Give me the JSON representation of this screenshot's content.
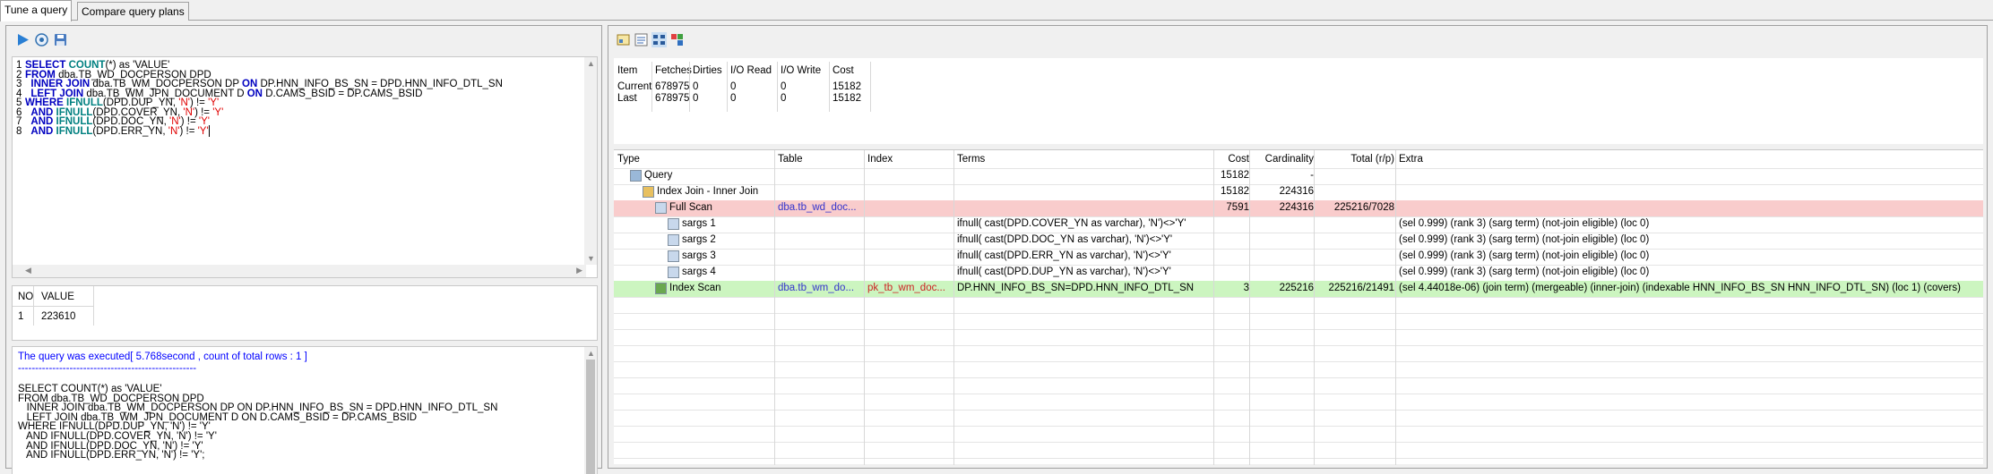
{
  "tabs": [
    {
      "label": "Tune a query",
      "active": true
    },
    {
      "label": "Compare query plans",
      "active": false
    }
  ],
  "toolbar_left": {
    "icons": [
      "run-icon",
      "explain-icon",
      "save-icon"
    ]
  },
  "editor": {
    "lines": [
      {
        "n": "1",
        "parts": [
          [
            "kw",
            "SELECT "
          ],
          [
            "fn",
            "COUNT"
          ],
          [
            "",
            "(*) as 'VALUE'"
          ]
        ]
      },
      {
        "n": "2",
        "parts": [
          [
            "kw",
            "FROM "
          ],
          [
            "",
            "dba.TB_WD_DOCPERSON DPD"
          ]
        ]
      },
      {
        "n": "3",
        "parts": [
          [
            "",
            "  "
          ],
          [
            "kw",
            "INNER JOIN "
          ],
          [
            "",
            "dba.TB_WM_DOCPERSON DP "
          ],
          [
            "kw",
            "ON "
          ],
          [
            "",
            "DP.HNN_INFO_BS_SN = DPD.HNN_INFO_DTL_SN"
          ]
        ]
      },
      {
        "n": "4",
        "parts": [
          [
            "",
            "  "
          ],
          [
            "kw",
            "LEFT JOIN "
          ],
          [
            "",
            "dba.TB_WM_JPN_DOCUMENT D "
          ],
          [
            "kw",
            "ON "
          ],
          [
            "",
            "D.CAMS_BSID = DP.CAMS_BSID"
          ]
        ]
      },
      {
        "n": "5",
        "parts": [
          [
            "kw",
            "WHERE "
          ],
          [
            "fn",
            "IFNULL"
          ],
          [
            "",
            "(DPD.DUP_YN, "
          ],
          [
            "str",
            "'N'"
          ],
          [
            "",
            ") != "
          ],
          [
            "str",
            "'Y'"
          ]
        ]
      },
      {
        "n": "6",
        "parts": [
          [
            "",
            "  "
          ],
          [
            "kw",
            "AND "
          ],
          [
            "fn",
            "IFNULL"
          ],
          [
            "",
            "(DPD.COVER_YN, "
          ],
          [
            "str",
            "'N'"
          ],
          [
            "",
            ") != "
          ],
          [
            "str",
            "'Y'"
          ]
        ]
      },
      {
        "n": "7",
        "parts": [
          [
            "",
            "  "
          ],
          [
            "kw",
            "AND "
          ],
          [
            "fn",
            "IFNULL"
          ],
          [
            "",
            "(DPD.DOC_YN, "
          ],
          [
            "str",
            "'N'"
          ],
          [
            "",
            ") != "
          ],
          [
            "str",
            "'Y'"
          ]
        ]
      },
      {
        "n": "8",
        "parts": [
          [
            "",
            "  "
          ],
          [
            "kw",
            "AND "
          ],
          [
            "fn",
            "IFNULL"
          ],
          [
            "",
            "(DPD.ERR_YN, "
          ],
          [
            "str",
            "'N'"
          ],
          [
            "",
            ") != "
          ],
          [
            "str",
            "'Y'"
          ]
        ]
      }
    ]
  },
  "result_grid": {
    "headers": [
      "NO",
      "VALUE"
    ],
    "rows": [
      [
        "1",
        "223610"
      ]
    ]
  },
  "console": {
    "status": "The query was executed[ 5.768second , count of total rows : 1 ]",
    "separator": "----------------------------------------------------",
    "sql_lines": [
      "SELECT COUNT(*) as 'VALUE'",
      "FROM dba.TB_WD_DOCPERSON DPD",
      "   INNER JOIN dba.TB_WM_DOCPERSON DP ON DP.HNN_INFO_BS_SN = DPD.HNN_INFO_DTL_SN",
      "   LEFT JOIN dba.TB_WM_JPN_DOCUMENT D ON D.CAMS_BSID = DP.CAMS_BSID",
      "WHERE IFNULL(DPD.DUP_YN, 'N') != 'Y'",
      "   AND IFNULL(DPD.COVER_YN, 'N') != 'Y'",
      "   AND IFNULL(DPD.DOC_YN, 'N') != 'Y'",
      "   AND IFNULL(DPD.ERR_YN, 'N') != 'Y';"
    ]
  },
  "toolbar_right": {
    "icons": [
      "plan-graph-icon",
      "plan-text-icon",
      "plan-tree-icon",
      "plan-compare-icon"
    ]
  },
  "stats": {
    "headers": [
      "Item",
      "Fetches",
      "Dirties",
      "I/O Read",
      "I/O Write",
      "Cost"
    ],
    "rows": [
      [
        "Current",
        "678975",
        "0",
        "0",
        "0",
        "15182"
      ],
      [
        "Last",
        "678975",
        "0",
        "0",
        "0",
        "15182"
      ]
    ]
  },
  "plan": {
    "headers": [
      "Type",
      "Table",
      "Index",
      "Terms",
      "Cost",
      "Cardinality",
      "Total (r/p)",
      "Extra"
    ],
    "rows": [
      {
        "type": "Query",
        "icon": "query-icon",
        "indent": 0,
        "table": "",
        "index": "",
        "terms": "",
        "cost": "15182",
        "card": "-",
        "total": "",
        "extra": "",
        "hl": ""
      },
      {
        "type": "Index Join - Inner Join",
        "icon": "folder-icon",
        "indent": 1,
        "table": "",
        "index": "",
        "terms": "",
        "cost": "15182",
        "card": "224316",
        "total": "",
        "extra": "",
        "hl": ""
      },
      {
        "type": "Full Scan",
        "icon": "scan-icon",
        "indent": 2,
        "table": "dba.tb_wd_doc...",
        "index": "",
        "terms": "",
        "cost": "7591",
        "card": "224316",
        "total": "225216/7028",
        "extra": "",
        "hl": "red"
      },
      {
        "type": "sargs 1",
        "icon": "sarg-icon",
        "indent": 3,
        "table": "",
        "index": "",
        "terms": "ifnull( cast(DPD.COVER_YN as varchar), 'N')<>'Y'",
        "cost": "",
        "card": "",
        "total": "",
        "extra": "(sel 0.999) (rank 3) (sarg term) (not-join eligible) (loc 0)",
        "hl": ""
      },
      {
        "type": "sargs 2",
        "icon": "sarg-icon",
        "indent": 3,
        "table": "",
        "index": "",
        "terms": "ifnull( cast(DPD.DOC_YN as varchar), 'N')<>'Y'",
        "cost": "",
        "card": "",
        "total": "",
        "extra": "(sel 0.999) (rank 3) (sarg term) (not-join eligible) (loc 0)",
        "hl": ""
      },
      {
        "type": "sargs 3",
        "icon": "sarg-icon",
        "indent": 3,
        "table": "",
        "index": "",
        "terms": "ifnull( cast(DPD.ERR_YN as varchar), 'N')<>'Y'",
        "cost": "",
        "card": "",
        "total": "",
        "extra": "(sel 0.999) (rank 3) (sarg term) (not-join eligible) (loc 0)",
        "hl": ""
      },
      {
        "type": "sargs 4",
        "icon": "sarg-icon",
        "indent": 3,
        "table": "",
        "index": "",
        "terms": "ifnull( cast(DPD.DUP_YN as varchar), 'N')<>'Y'",
        "cost": "",
        "card": "",
        "total": "",
        "extra": "(sel 0.999) (rank 3) (sarg term) (not-join eligible) (loc 0)",
        "hl": ""
      },
      {
        "type": "Index Scan",
        "icon": "index-scan-icon",
        "indent": 2,
        "table": "dba.tb_wm_do...",
        "index": "pk_tb_wm_doc...",
        "terms": "DP.HNN_INFO_BS_SN=DPD.HNN_INFO_DTL_SN",
        "cost": "3",
        "card": "225216",
        "total": "225216/21491",
        "extra": "(sel 4.44018e-06) (join term) (mergeable) (inner-join) (indexable HNN_INFO_BS_SN HNN_INFO_DTL_SN) (loc 1) (covers)",
        "hl": "green"
      }
    ]
  },
  "colors": {
    "keyword": "#0000c0",
    "function": "#008080",
    "string": "#e00000",
    "row_red": "#f9cccc",
    "row_green": "#ccf5c0",
    "link": "#3333cc"
  }
}
